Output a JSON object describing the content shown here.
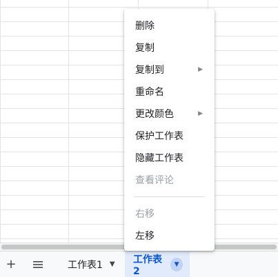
{
  "menu": {
    "delete": "删除",
    "duplicate": "复制",
    "copy_to": "复制到",
    "rename": "重命名",
    "change_color": "更改颜色",
    "protect_sheet": "保护工作表",
    "hide_sheet": "隐藏工作表",
    "view_comments": "查看评论",
    "move_right": "右移",
    "move_left": "左移"
  },
  "sheetbar": {
    "add_icon": "+",
    "all_sheets_icon": "≡",
    "tabs": [
      {
        "label": "工作表1",
        "active": false
      },
      {
        "label": "工作表2",
        "active": true
      }
    ]
  },
  "colors": {
    "active_tab_bg": "#e1ebfb",
    "active_tab_text": "#0b57d0",
    "disabled_text": "#9aa0a6"
  },
  "icons": {
    "submenu": "submenu-arrow-icon",
    "tab_menu": "caret-down-icon",
    "add": "plus-icon",
    "list": "hamburger-icon"
  }
}
